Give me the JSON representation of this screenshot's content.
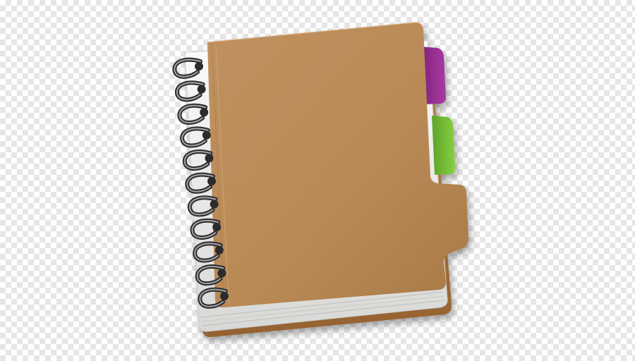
{
  "image": {
    "subject": "spiral-notebook-icon",
    "background": "transparency-checkerboard",
    "colors": {
      "cover": "#b98a56",
      "cover_dark": "#8e6538",
      "back_board": "#a9773e",
      "pages": "#f2f2f0",
      "tab_top": "#9b2f96",
      "tab_middle": "#7bc33a",
      "ring": "#3c3c3e",
      "checker_light": "#ffffff",
      "checker_dark": "#e6e6e6"
    },
    "ring_count": 11,
    "tab_count": 3
  }
}
